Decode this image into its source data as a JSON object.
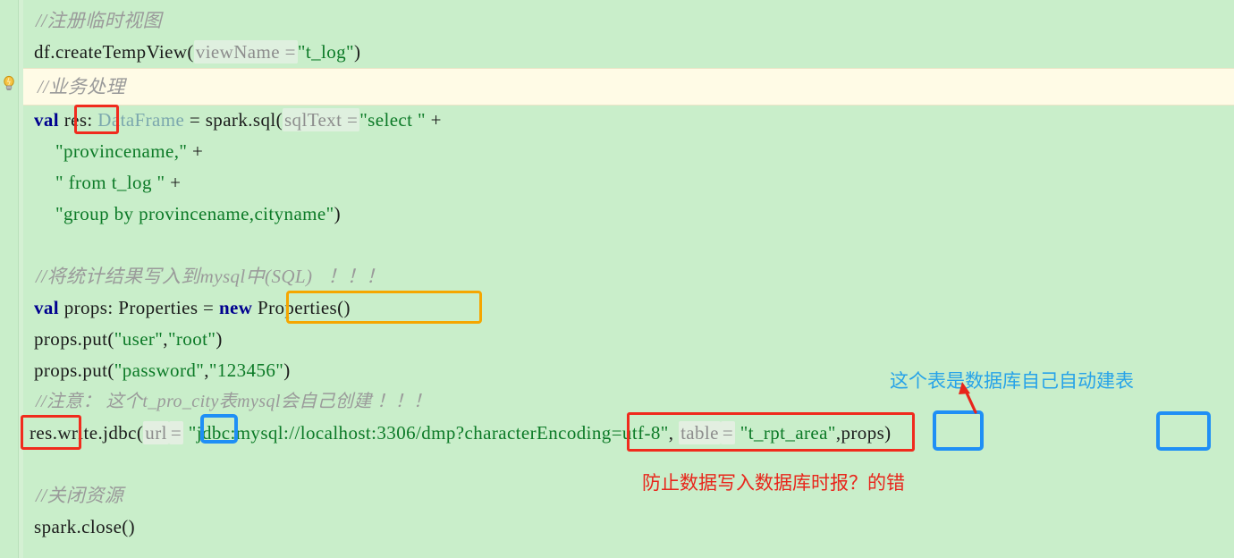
{
  "editor": {
    "background_color": "#c9eeca",
    "caret_line_color": "#fffbe6",
    "language": "scala"
  },
  "gutter": {
    "bulb_icon": "lightbulb-icon",
    "bulb_glyph": "💡"
  },
  "code": {
    "lines": [
      {
        "id": "l1",
        "text": "//注册临时视图"
      },
      {
        "id": "l2a",
        "text": "df.createTempView("
      },
      {
        "id": "l2b",
        "text": "viewName ="
      },
      {
        "id": "l2c",
        "text": "\"t_log\""
      },
      {
        "id": "l2d",
        "text": ")"
      },
      {
        "id": "l3",
        "text": "//业务处理"
      },
      {
        "id": "l4a",
        "text": "val"
      },
      {
        "id": "l4b",
        "text": "res"
      },
      {
        "id": "l4c",
        "text": ":"
      },
      {
        "id": "l4d",
        "text": "DataFrame"
      },
      {
        "id": "l4e",
        "text": "= spark.sql("
      },
      {
        "id": "l4f",
        "text": "sqlText ="
      },
      {
        "id": "l4g",
        "text": "\"select \""
      },
      {
        "id": "l4h",
        "text": "+"
      },
      {
        "id": "l5a",
        "text": "\"provincename,\""
      },
      {
        "id": "l5b",
        "text": "+"
      },
      {
        "id": "l6a",
        "text": "\" from t_log \""
      },
      {
        "id": "l6b",
        "text": "+"
      },
      {
        "id": "l7a",
        "text": "\"group by provincename,cityname\""
      },
      {
        "id": "l7b",
        "text": ")"
      },
      {
        "id": "l8",
        "text": "//将统计结果写入到mysql中(SQL)   ！！！"
      },
      {
        "id": "l9a",
        "text": "val"
      },
      {
        "id": "l9b",
        "text": "props: Properties ="
      },
      {
        "id": "l9c",
        "text": "new"
      },
      {
        "id": "l9d",
        "text": "Properties()"
      },
      {
        "id": "l10a",
        "text": "props.put("
      },
      {
        "id": "l10b",
        "text": "\"user\""
      },
      {
        "id": "l10c",
        "text": ","
      },
      {
        "id": "l10d",
        "text": "\"root\""
      },
      {
        "id": "l10e",
        "text": ")"
      },
      {
        "id": "l11a",
        "text": "props.put("
      },
      {
        "id": "l11b",
        "text": "\"password\""
      },
      {
        "id": "l11c",
        "text": ","
      },
      {
        "id": "l11d",
        "text": "\"123456\""
      },
      {
        "id": "l11e",
        "text": ")"
      },
      {
        "id": "l12",
        "text": "//注意： 这个t_pro_city表mysql会自己创建 ！！！"
      },
      {
        "id": "l13a",
        "text": "res"
      },
      {
        "id": "l13b",
        "text": ".write.jdbc("
      },
      {
        "id": "l13c",
        "text": "url"
      },
      {
        "id": "l13d",
        "text": "="
      },
      {
        "id": "l13e",
        "text": "\"jdbc:mysql://localhost:3306/dmp"
      },
      {
        "id": "l13f",
        "text": "?characterEncoding=utf-8"
      },
      {
        "id": "l13g",
        "text": "\""
      },
      {
        "id": "l13h",
        "text": ","
      },
      {
        "id": "l13i",
        "text": "table"
      },
      {
        "id": "l13j",
        "text": "="
      },
      {
        "id": "l13k",
        "text": "\"t_rpt_area\""
      },
      {
        "id": "l13l",
        "text": ","
      },
      {
        "id": "l13m",
        "text": "props"
      },
      {
        "id": "l13n",
        "text": ")"
      },
      {
        "id": "l14",
        "text": "//关闭资源"
      },
      {
        "id": "l15",
        "text": "spark.close()"
      }
    ]
  },
  "annotations": {
    "table_note": {
      "text": "这个表是数据库自己自动建表",
      "color": "#27a3e8"
    },
    "encoding_note": {
      "text": "防止数据写入数据库时报？的错",
      "color": "#e8251b"
    },
    "boxes": [
      {
        "name": "res-declaration-box",
        "color": "#f02b1d"
      },
      {
        "name": "new-properties-box",
        "color": "#f5a600"
      },
      {
        "name": "res-write-box",
        "color": "#f02b1d"
      },
      {
        "name": "url-param-box",
        "color": "#1f8ff5"
      },
      {
        "name": "character-encoding-box",
        "color": "#f02b1d"
      },
      {
        "name": "table-param-box",
        "color": "#1f8ff5"
      },
      {
        "name": "props-param-box",
        "color": "#1f8ff5"
      }
    ]
  }
}
